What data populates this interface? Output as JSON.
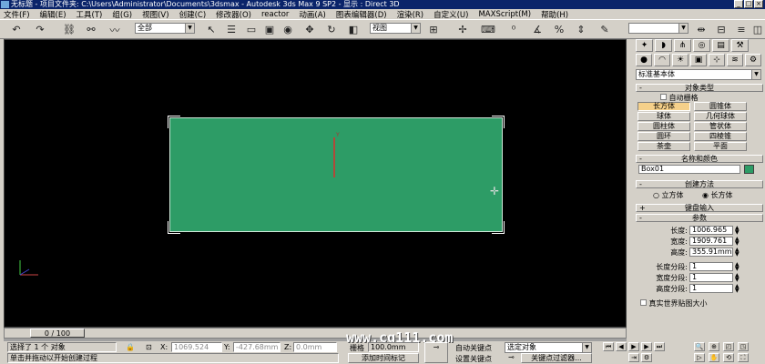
{
  "window": {
    "title": "无标题  -  项目文件夹: C:\\Users\\Administrator\\Documents\\3dsmax  -  Autodesk 3ds Max 9 SP2  -  显示 : Direct 3D",
    "controls": [
      "_",
      "□",
      "×"
    ]
  },
  "menu": {
    "items": [
      "文件(F)",
      "编辑(E)",
      "工具(T)",
      "组(G)",
      "视图(V)",
      "创建(C)",
      "修改器(O)",
      "reactor",
      "动画(A)",
      "图表编辑器(D)",
      "渲染(R)",
      "自定义(U)",
      "MAXScript(M)",
      "帮助(H)"
    ]
  },
  "toolbar": {
    "selection_filter": "全部",
    "reference_coord": "视图",
    "named_selection": ""
  },
  "viewport": {
    "gizmo_label": "Y"
  },
  "command_panel": {
    "category": "标准基本体",
    "object_type_title": "对象类型",
    "autogrid_label": "自动栅格",
    "object_buttons": [
      "长方体",
      "圆锥体",
      "球体",
      "几何球体",
      "圆柱体",
      "管状体",
      "圆环",
      "四棱锥",
      "茶壶",
      "平面"
    ],
    "active_button": "长方体",
    "name_color_title": "名称和颜色",
    "object_name": "Box01",
    "object_color": "#2d9c66",
    "creation_method_title": "创建方法",
    "creation_options": [
      "立方体",
      "长方体"
    ],
    "creation_selected": "长方体",
    "keyboard_entry_title": "键盘输入",
    "parameters_title": "参数",
    "params": [
      {
        "label": "长度:",
        "value": "1006.965"
      },
      {
        "label": "宽度:",
        "value": "1909.761"
      },
      {
        "label": "高度:",
        "value": "355.91mm"
      }
    ],
    "segments": [
      {
        "label": "长度分段:",
        "value": "1"
      },
      {
        "label": "宽度分段:",
        "value": "1"
      },
      {
        "label": "高度分段:",
        "value": "1"
      }
    ],
    "real_world_label": "真实世界贴图大小"
  },
  "timeline": {
    "frame_display": "0 / 100"
  },
  "status": {
    "selection_text": "选择了 1 个 对象",
    "prompt_text": "单击并拖动以开始创建过程",
    "x_label": "X:",
    "x_value": "1069.524",
    "y_label": "Y:",
    "y_value": "-427.68mm",
    "z_label": "Z:",
    "z_value": "0.0mm",
    "grid_label": "栅格",
    "grid_value": "100.0mm",
    "add_time_tag": "添加时间标记",
    "auto_key": "自动关键点",
    "set_key": "设置关键点",
    "key_filter_select": "选定对象",
    "key_filters": "关键点过滤器..."
  },
  "watermark": "www.cg111.com"
}
